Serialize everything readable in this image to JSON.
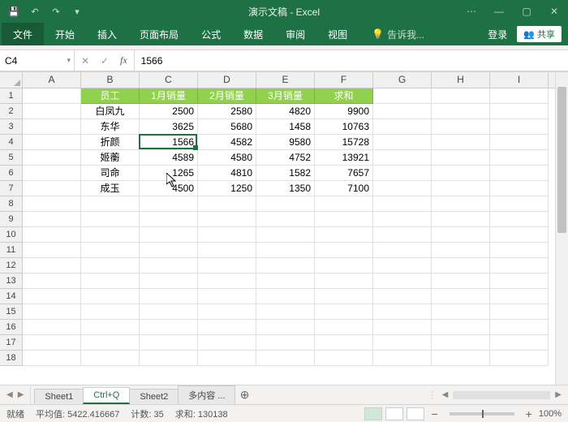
{
  "app": {
    "title": "演示文稿 - Excel"
  },
  "ribbon": {
    "file": "文件",
    "tabs": [
      "开始",
      "插入",
      "页面布局",
      "公式",
      "数据",
      "审阅",
      "视图"
    ],
    "tell_me": "告诉我...",
    "signin": "登录",
    "share": "共享"
  },
  "name_box": "C4",
  "formula_value": "1566",
  "columns": [
    "A",
    "B",
    "C",
    "D",
    "E",
    "F",
    "G",
    "H",
    "I"
  ],
  "row_count": 18,
  "table": {
    "headers": [
      "员工",
      "1月销量",
      "2月销量",
      "3月销量",
      "求和"
    ],
    "rows": [
      {
        "emp": "白凤九",
        "m1": 2500,
        "m2": 2580,
        "m3": 4820,
        "sum": 9900
      },
      {
        "emp": "东华",
        "m1": 3625,
        "m2": 5680,
        "m3": 1458,
        "sum": 10763
      },
      {
        "emp": "折颜",
        "m1": 1566,
        "m2": 4582,
        "m3": 9580,
        "sum": 15728
      },
      {
        "emp": "姬蘅",
        "m1": 4589,
        "m2": 4580,
        "m3": 4752,
        "sum": 13921
      },
      {
        "emp": "司命",
        "m1": 1265,
        "m2": 4810,
        "m3": 1582,
        "sum": 7657
      },
      {
        "emp": "成玉",
        "m1": 4500,
        "m2": 1250,
        "m3": 1350,
        "sum": 7100
      }
    ]
  },
  "sheets": {
    "items": [
      "Sheet1",
      "Ctrl+Q",
      "Sheet2",
      "多内容 ..."
    ],
    "active": 1
  },
  "status": {
    "ready": "就绪",
    "avg_label": "平均值:",
    "avg": "5422.416667",
    "count_label": "计数:",
    "count": "35",
    "sum_label": "求和:",
    "sum": "130138",
    "zoom": "100%"
  },
  "active_cell": {
    "col": 2,
    "row": 3
  }
}
